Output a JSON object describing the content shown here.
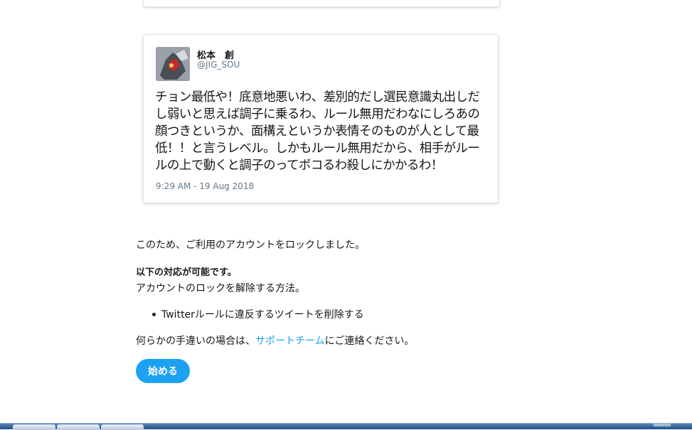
{
  "tweet": {
    "author_name": "松本　創",
    "author_handle": "@JIG_SOU",
    "text": "チョン最低や！底意地悪いわ、差別的だし選民意識丸出しだし弱いと思えば調子に乗るわ、ルール無用だわなにしろあの顔つきというか、面構えというか表情そのものが人として最低！！と言うレベル。しかもルール無用だから、相手がルールの上で動くと調子のってボコるわ殺しにかかるわ！",
    "timestamp": "9:29 AM - 19 Aug 2018"
  },
  "notice": {
    "locked_message": "このため、ご利用のアカウントをロックしました。",
    "options_heading": "以下の対応が可能です。",
    "unlock_intro": "アカウントのロックを解除する方法。",
    "bullet_item": "Twitterルールに違反するツイートを削除する",
    "contact_prefix": "何らかの手違いの場合は、",
    "support_link": "サポートチーム",
    "contact_suffix": "にご連絡ください。"
  },
  "start_button_label": "始める",
  "colors": {
    "accent": "#1da1f2",
    "muted_text": "#657786",
    "card_border": "#e1e8ed"
  },
  "icons": {
    "avatar": "avatar-image",
    "bullet": "bullet-dot"
  }
}
